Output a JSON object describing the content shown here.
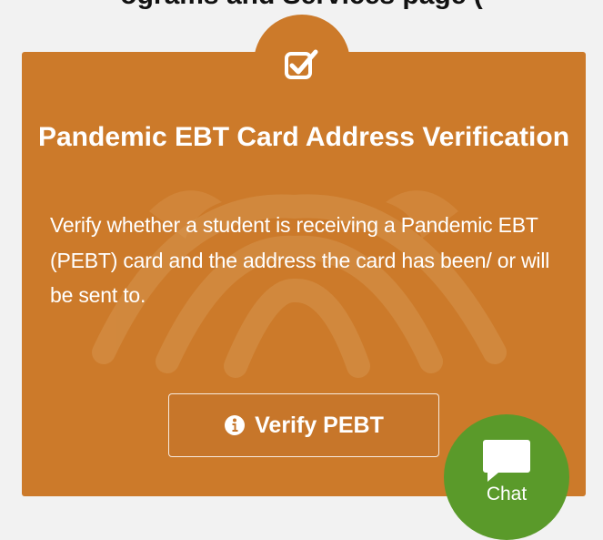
{
  "page": {
    "heading_fragment": "ograms and Services page ("
  },
  "card": {
    "title": "Pandemic EBT Card Address Verification",
    "description": "Verify whether a student is receiving a Pandemic EBT (PEBT) card and the address the card has been/ or will be sent to.",
    "icon": "checkbox-check-icon",
    "background_color": "#cc7a2a",
    "button": {
      "label": "Verify PEBT",
      "icon": "info-circle-icon"
    }
  },
  "chat": {
    "label": "Chat",
    "icon": "chat-bubble-icon",
    "background_color": "#5a9a2a"
  }
}
